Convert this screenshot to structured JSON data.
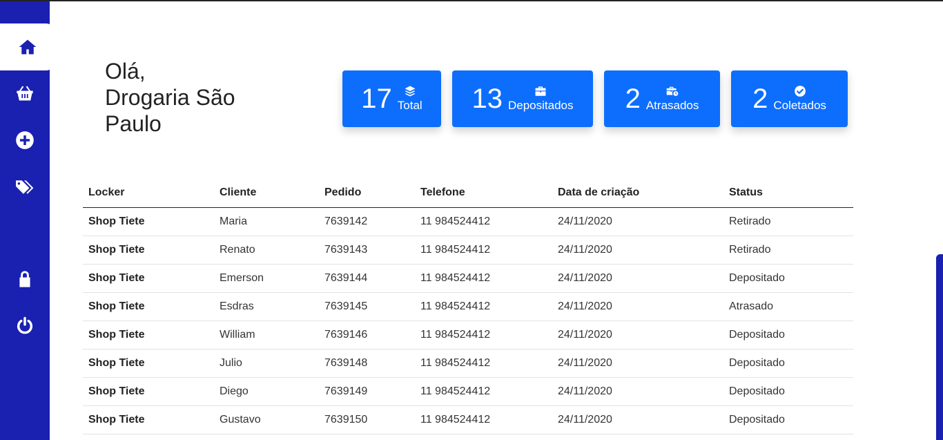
{
  "sidebar": {
    "items": [
      {
        "icon": "home-icon",
        "active": true
      },
      {
        "icon": "basket-icon",
        "active": false
      },
      {
        "icon": "plus-circle-icon",
        "active": false
      },
      {
        "icon": "tags-icon",
        "active": false
      },
      {
        "icon": "lock-icon",
        "active": false
      },
      {
        "icon": "power-icon",
        "active": false
      }
    ],
    "colors": {
      "background": "#1a20b0",
      "active_bg": "#ffffff"
    }
  },
  "greeting": {
    "line1": "Olá,",
    "line2": "Drogaria São Paulo"
  },
  "cards": [
    {
      "value": "17",
      "label": "Total",
      "icon": "layers-icon"
    },
    {
      "value": "13",
      "label": "Depositados",
      "icon": "briefcase-icon"
    },
    {
      "value": "2",
      "label": "Atrasados",
      "icon": "briefcase-clock-icon"
    },
    {
      "value": "2",
      "label": "Coletados",
      "icon": "check-circle-icon"
    }
  ],
  "card_color": "#0d6efd",
  "table": {
    "headers": [
      "Locker",
      "Cliente",
      "Pedido",
      "Telefone",
      "Data de criação",
      "Status"
    ],
    "rows": [
      [
        "Shop Tiete",
        "Maria",
        "7639142",
        "11 984524412",
        "24/11/2020",
        "Retirado"
      ],
      [
        "Shop Tiete",
        "Renato",
        "7639143",
        "11 984524412",
        "24/11/2020",
        "Retirado"
      ],
      [
        "Shop Tiete",
        "Emerson",
        "7639144",
        "11 984524412",
        "24/11/2020",
        "Depositado"
      ],
      [
        "Shop Tiete",
        "Esdras",
        "7639145",
        "11 984524412",
        "24/11/2020",
        "Atrasado"
      ],
      [
        "Shop Tiete",
        "William",
        "7639146",
        "11 984524412",
        "24/11/2020",
        "Depositado"
      ],
      [
        "Shop Tiete",
        "Julio",
        "7639148",
        "11 984524412",
        "24/11/2020",
        "Depositado"
      ],
      [
        "Shop Tiete",
        "Diego",
        "7639149",
        "11 984524412",
        "24/11/2020",
        "Depositado"
      ],
      [
        "Shop Tiete",
        "Gustavo",
        "7639150",
        "11 984524412",
        "24/11/2020",
        "Depositado"
      ]
    ]
  }
}
